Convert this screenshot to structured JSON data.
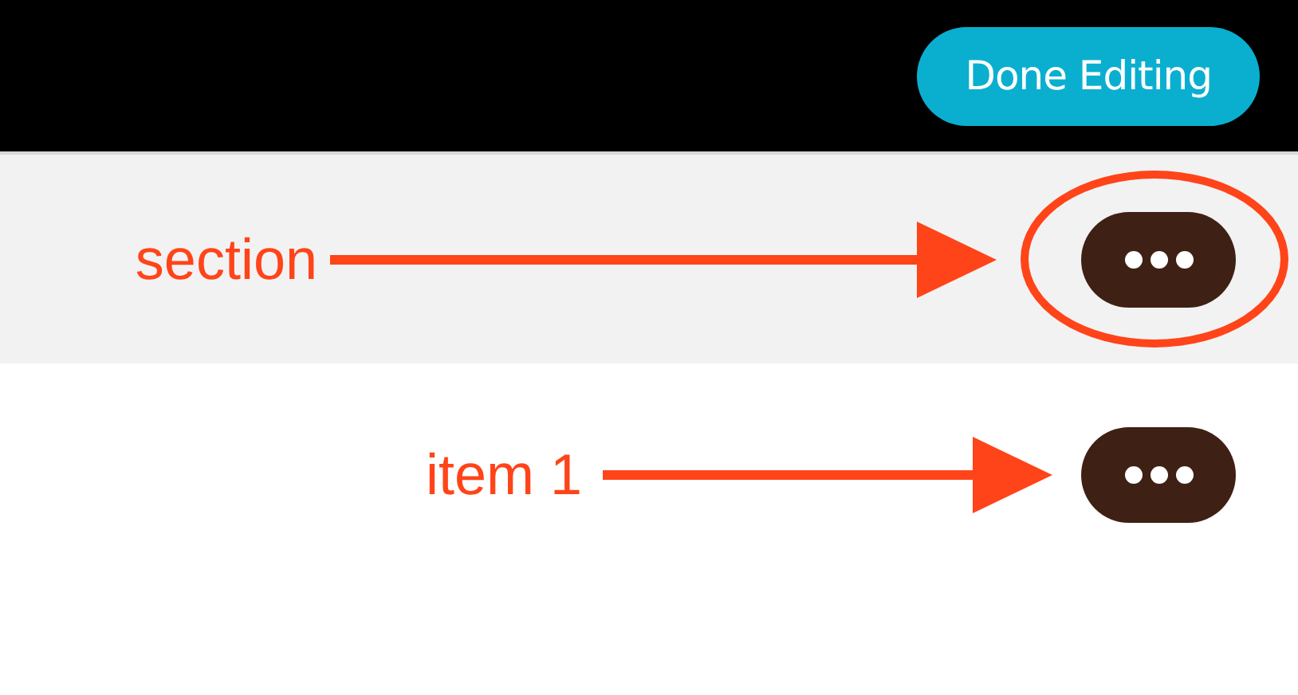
{
  "toolbar": {
    "done_button": "Done Editing"
  },
  "rows": [
    {
      "kind": "section",
      "annotation": "section",
      "circled": true
    },
    {
      "kind": "item",
      "annotation": "item 1",
      "circled": false
    }
  ]
}
